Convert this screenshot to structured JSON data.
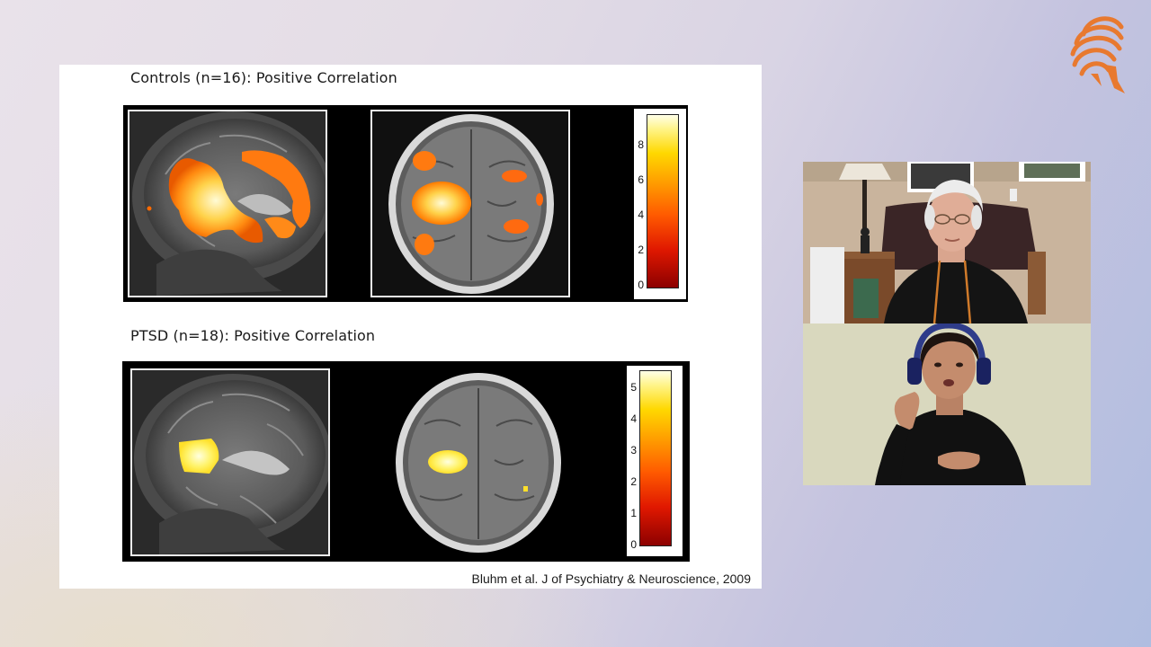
{
  "slide": {
    "controls_panel": {
      "title": "Controls (n=16): Positive Correlation",
      "colorbar_ticks": [
        "8",
        "6",
        "4",
        "2",
        "0"
      ]
    },
    "ptsd_panel": {
      "title": "PTSD (n=18): Positive Correlation",
      "colorbar_ticks": [
        "5",
        "4",
        "3",
        "2",
        "1",
        "0"
      ]
    },
    "citation": "Bluhm et al. J of Psychiatry & Neuroscience, 2009"
  },
  "colors": {
    "hot_low": "#8c0000",
    "hot_mid": "#ff7a00",
    "hot_high": "#fff7a0",
    "logo": "#e8792f"
  },
  "icons": {
    "logo": "spartan-helmet-logo"
  }
}
